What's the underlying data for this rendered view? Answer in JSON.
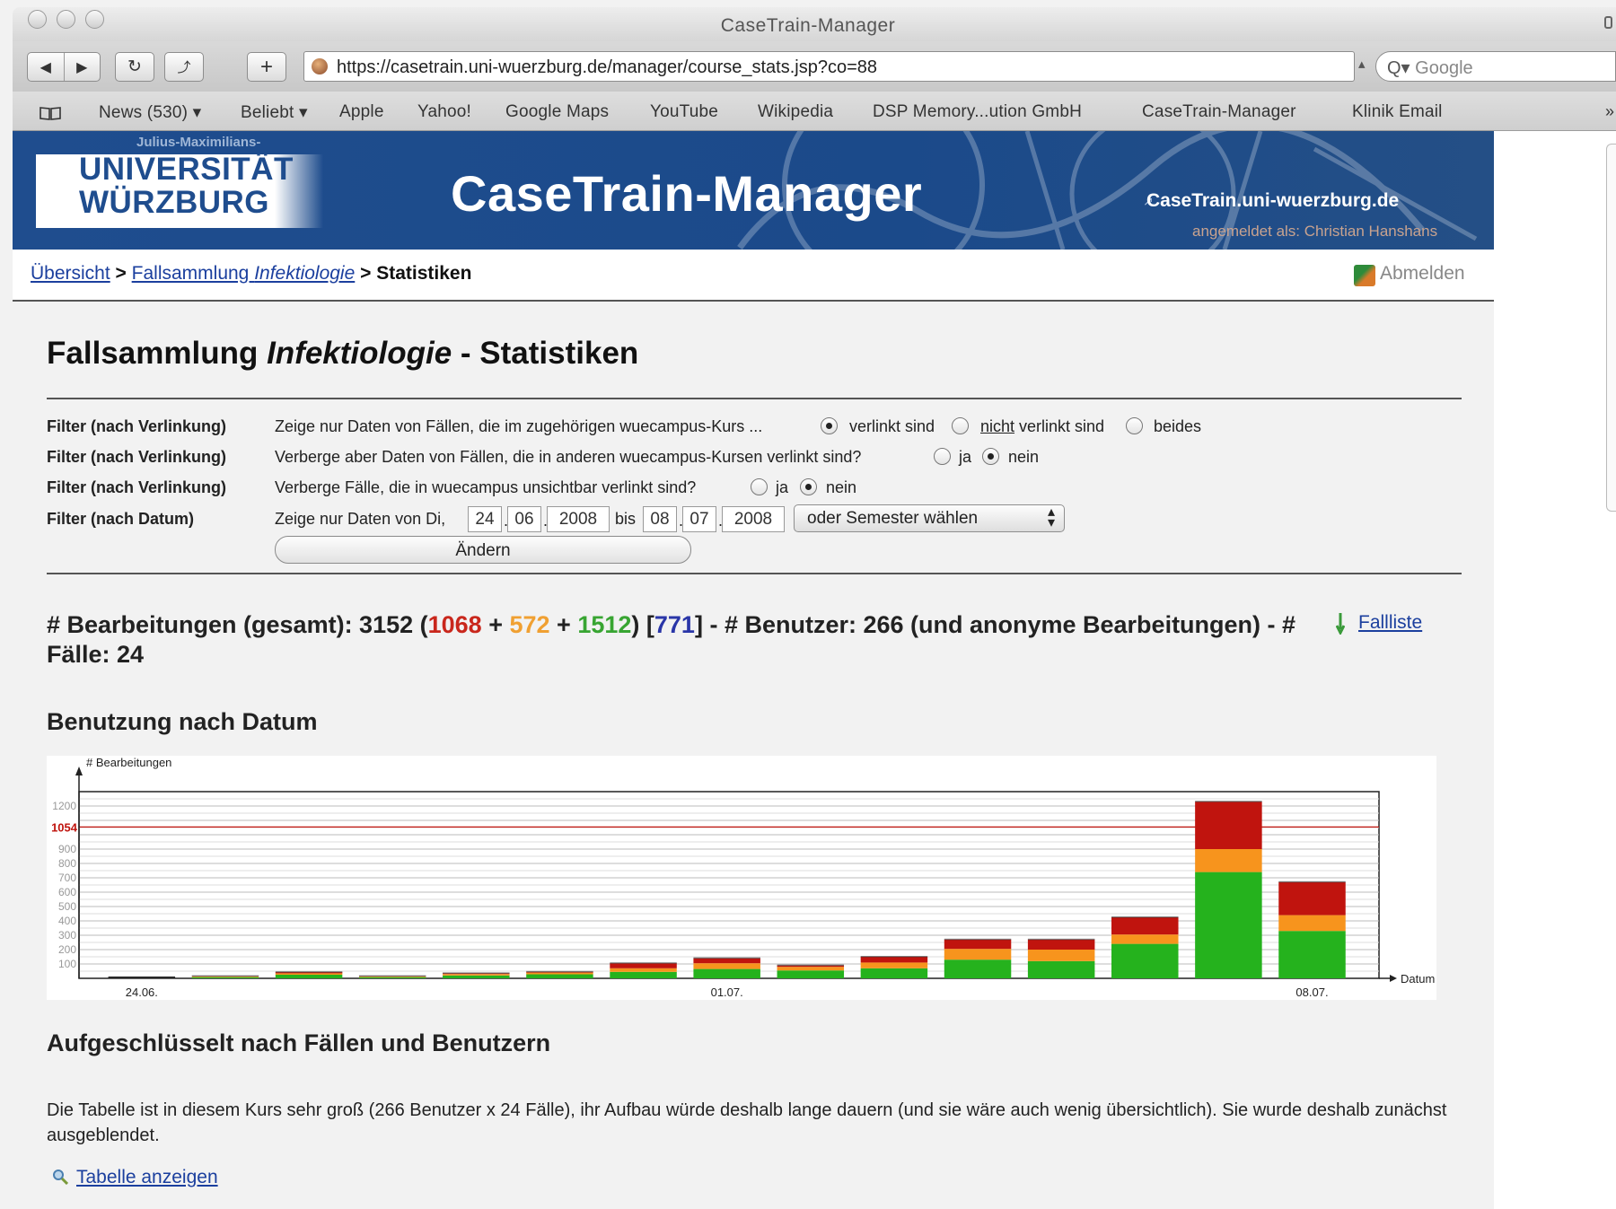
{
  "window": {
    "title": "CaseTrain-Manager"
  },
  "browser": {
    "url": "https://casetrain.uni-wuerzburg.de/manager/course_stats.jsp?co=88",
    "search_placeholder": "Google",
    "search_prefix": "Q▾",
    "bookmarks": [
      "News (530) ▾",
      "Beliebt ▾",
      "Apple",
      "Yahoo!",
      "Google Maps",
      "YouTube",
      "Wikipedia",
      "DSP Memory...ution GmbH",
      "CaseTrain-Manager",
      "Klinik Email"
    ],
    "more_bookmarks": "»"
  },
  "banner": {
    "logo_small": "Julius-Maximilians-",
    "logo_line1": "UNIVERSITÄT",
    "logo_line2": "WÜRZBURG",
    "app_title": "CaseTrain-Manager",
    "site_link": "CaseTrain.uni-wuerzburg.de",
    "logged_in": "angemeldet als: Christian Hanshans"
  },
  "nav": {
    "crumb_overview": "Übersicht",
    "crumb_sep": ">",
    "crumb_collection_prefix": "Fallsammlung ",
    "crumb_collection_topic": "Infektiologie",
    "crumb_current": "Statistiken",
    "logout": "Abmelden"
  },
  "page": {
    "title_prefix": "Fallsammlung ",
    "title_topic": "Infektiologie",
    "title_suffix": " - Statistiken"
  },
  "filters": {
    "row1": {
      "label": "Filter (nach Verlinkung)",
      "text": "Zeige nur Daten von Fällen, die im zugehörigen wuecampus-Kurs ...",
      "opt1": "verlinkt sind",
      "opt2_em": "nicht",
      "opt2_rest": " verlinkt sind",
      "opt3": "beides",
      "selected": "verlinkt sind"
    },
    "row2": {
      "label": "Filter (nach Verlinkung)",
      "text": "Verberge aber Daten von Fällen, die in anderen wuecampus-Kursen verlinkt sind?",
      "opt1": "ja",
      "opt2": "nein",
      "selected": "nein"
    },
    "row3": {
      "label": "Filter (nach Verlinkung)",
      "text": "Verberge Fälle, die in wuecampus unsichtbar verlinkt sind?",
      "opt1": "ja",
      "opt2": "nein",
      "selected": "nein"
    },
    "row4": {
      "label": "Filter (nach Datum)",
      "text": "Zeige nur Daten von Di,",
      "from_day": "24",
      "from_month": "06",
      "from_year": "2008",
      "between": "bis",
      "to_day": "08",
      "to_month": "07",
      "to_year": "2008",
      "semester": "oder Semester wählen",
      "dot": "."
    },
    "submit": "Ändern"
  },
  "stats": {
    "prefix": "# Bearbeitungen (gesamt): 3152 (",
    "red": "1068",
    "plus1": " + ",
    "orange": "572",
    "plus2": " + ",
    "green": "1512",
    "mid": ") [",
    "blue": "771",
    "suffix": "] - # Benutzer: 266 (und anonyme Bearbeitungen) - # Fälle: 24",
    "case_list": "Fallliste",
    "colors": {
      "red": "#c9271c",
      "orange": "#f0a032",
      "green": "#38a532",
      "blue": "#2a36a8"
    }
  },
  "usage_heading": "Benutzung nach Datum",
  "chart_data": {
    "type": "bar",
    "stacked": true,
    "ylabel": "# Bearbeitungen",
    "xlabel": "Datum",
    "x_tick_labels": [
      "24.06.",
      "01.07.",
      "08.07."
    ],
    "y_ticks": [
      100,
      200,
      300,
      400,
      500,
      600,
      700,
      800,
      900,
      1200
    ],
    "highlight_line": {
      "value": 1054,
      "label": "1054"
    },
    "categories": [
      "24.06.",
      "25.06.",
      "26.06.",
      "27.06.",
      "28.06.",
      "29.06.",
      "30.06.",
      "01.07.",
      "02.07.",
      "03.07.",
      "04.07.",
      "05.07.",
      "06.07.",
      "07.07.",
      "08.07."
    ],
    "series": [
      {
        "color": "#25b21d",
        "values": [
          0,
          8,
          25,
          8,
          20,
          28,
          45,
          65,
          55,
          70,
          130,
          120,
          240,
          740,
          330
        ]
      },
      {
        "color": "#f7941d",
        "values": [
          0,
          5,
          10,
          5,
          10,
          12,
          25,
          40,
          25,
          40,
          75,
          80,
          65,
          160,
          110
        ]
      },
      {
        "color": "#c0140e",
        "values": [
          0,
          2,
          8,
          2,
          5,
          5,
          35,
          35,
          10,
          40,
          65,
          70,
          120,
          330,
          230
        ]
      }
    ],
    "ylim": [
      0,
      1300
    ],
    "grid": true
  },
  "breakdown_heading": "Aufgeschlüsselt nach Fällen und Benutzern",
  "breakdown": {
    "text": "Die Tabelle ist in diesem Kurs sehr groß (266 Benutzer x 24 Fälle), ihr Aufbau würde deshalb lange dauern (und sie wäre auch wenig übersichtlich). Sie wurde deshalb zunächst ausgeblendet.",
    "show_table": "Tabelle anzeigen"
  }
}
